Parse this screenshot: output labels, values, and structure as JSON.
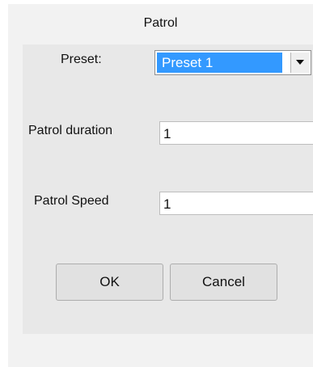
{
  "dialog": {
    "title": "Patrol",
    "preset": {
      "label": "Preset:",
      "selected": "Preset 1"
    },
    "duration": {
      "label": "Patrol duration",
      "value": "1"
    },
    "speed": {
      "label": "Patrol Speed",
      "value": "1"
    },
    "buttons": {
      "ok": "OK",
      "cancel": "Cancel"
    }
  },
  "icons": {
    "dropdown": "chevron-down-icon"
  },
  "colors": {
    "selection": "#3399ff",
    "dialog_bg": "#f2f2f2",
    "panel_bg": "#e8e8e8"
  }
}
